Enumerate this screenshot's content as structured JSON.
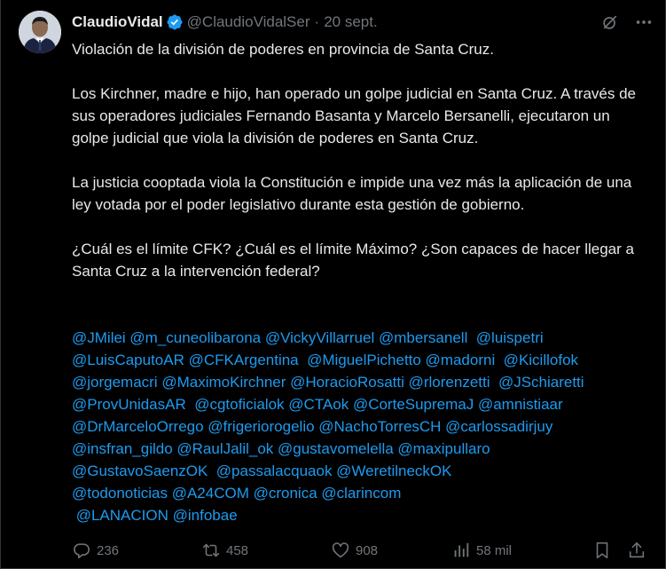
{
  "author": {
    "display_name": "ClaudioVidal",
    "handle": "@ClaudioVidalSer",
    "dot": "·",
    "date": "20 sept."
  },
  "tweet": {
    "paragraphs": [
      "Violación de la división de poderes en provincia de Santa Cruz.",
      "Los Kirchner, madre e hijo, han operado un golpe judicial en Santa Cruz. A través de sus operadores judiciales Fernando Basanta y Marcelo Bersanelli, ejecutaron un golpe judicial que viola la división de poderes en Santa Cruz.",
      "La justicia cooptada viola la Constitución e impide una vez más la aplicación de una ley votada por el poder legislativo durante esta gestión de gobierno.",
      "¿Cuál es el límite CFK? ¿Cuál es el límite Máximo? ¿Son capaces de hacer llegar a Santa Cruz a la intervención federal?"
    ],
    "mention_lines": [
      "@JMilei @m_cuneolibarona @VickyVillarruel @mbersanell  @luispetri",
      "@LuisCaputoAR @CFKArgentina  @MiguelPichetto @madorni  @Kicillofok",
      "@jorgemacri @MaximoKirchner @HoracioRosatti @rlorenzetti  @JSchiaretti",
      "@ProvUnidasAR  @cgtoficialok @CTAok @CorteSupremaJ @amnistiaar",
      "@DrMarceloOrrego @frigeriorogelio @NachoTorresCH @carlossadirjuy",
      "@insfran_gildo @RaulJalil_ok @gustavomelella @maxipullaro",
      "@GustavoSaenzOK  @passalacquaok @WeretilneckOK",
      "@todonoticias @A24COM @cronica @clarincom",
      " @LANACION @infobae"
    ]
  },
  "actions": {
    "replies": "236",
    "reposts": "458",
    "likes": "908",
    "views": "58 mil"
  },
  "icons": {
    "verified": "verified-badge-icon",
    "grok": "grok-icon",
    "more": "more-icon",
    "reply": "reply-icon",
    "repost": "repost-icon",
    "like": "heart-icon",
    "views": "views-icon",
    "bookmark": "bookmark-icon",
    "share": "share-icon"
  },
  "colors": {
    "background": "#000000",
    "text": "#e7e9ea",
    "secondary": "#71767b",
    "link": "#1d9bf0",
    "verified": "#1d9bf0"
  }
}
